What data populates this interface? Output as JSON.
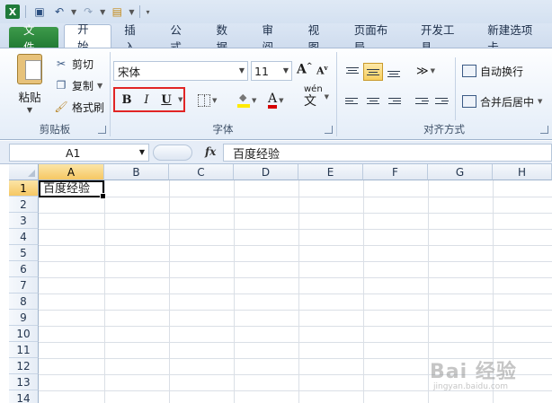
{
  "qat": {
    "app_icon_label": "X",
    "icons": [
      "excel-icon",
      "save-icon",
      "undo-icon",
      "redo-icon",
      "open-icon",
      "customize-icon"
    ]
  },
  "tabs": [
    {
      "label": "文件",
      "kind": "file"
    },
    {
      "label": "开始",
      "active": true
    },
    {
      "label": "插入"
    },
    {
      "label": "公式"
    },
    {
      "label": "数据"
    },
    {
      "label": "审阅"
    },
    {
      "label": "视图"
    },
    {
      "label": "页面布局"
    },
    {
      "label": "开发工具"
    },
    {
      "label": "新建选项卡"
    }
  ],
  "ribbon": {
    "clipboard": {
      "paste": "粘贴",
      "cut": "剪切",
      "copy": "复制",
      "format_painter": "格式刷",
      "group_label": "剪贴板"
    },
    "font": {
      "font_name": "宋体",
      "font_size": "11",
      "bold": "B",
      "italic": "I",
      "underline": "U",
      "font_color_glyph": "A",
      "phonetic_top": "wén",
      "phonetic_bottom": "文",
      "group_label": "字体",
      "fill_color": "#ffea00",
      "text_color": "#d60000",
      "highlight_box_color": "#e12525"
    },
    "alignment": {
      "wrap_text": "自动换行",
      "merge_center": "合并后居中",
      "group_label": "对齐方式"
    }
  },
  "formula_bar": {
    "name_box": "A1",
    "fx": "fx",
    "content": "百度经验"
  },
  "sheet": {
    "columns": [
      "A",
      "B",
      "C",
      "D",
      "E",
      "F",
      "G",
      "H"
    ],
    "rows": [
      "1",
      "2",
      "3",
      "4",
      "5",
      "6",
      "7",
      "8",
      "9",
      "10",
      "11",
      "12",
      "13",
      "14"
    ],
    "selected_cell": "A1",
    "a1_value": "百度经验"
  },
  "watermark": {
    "line1": "Bai 经验",
    "line2": "jingyan.baidu.com"
  }
}
